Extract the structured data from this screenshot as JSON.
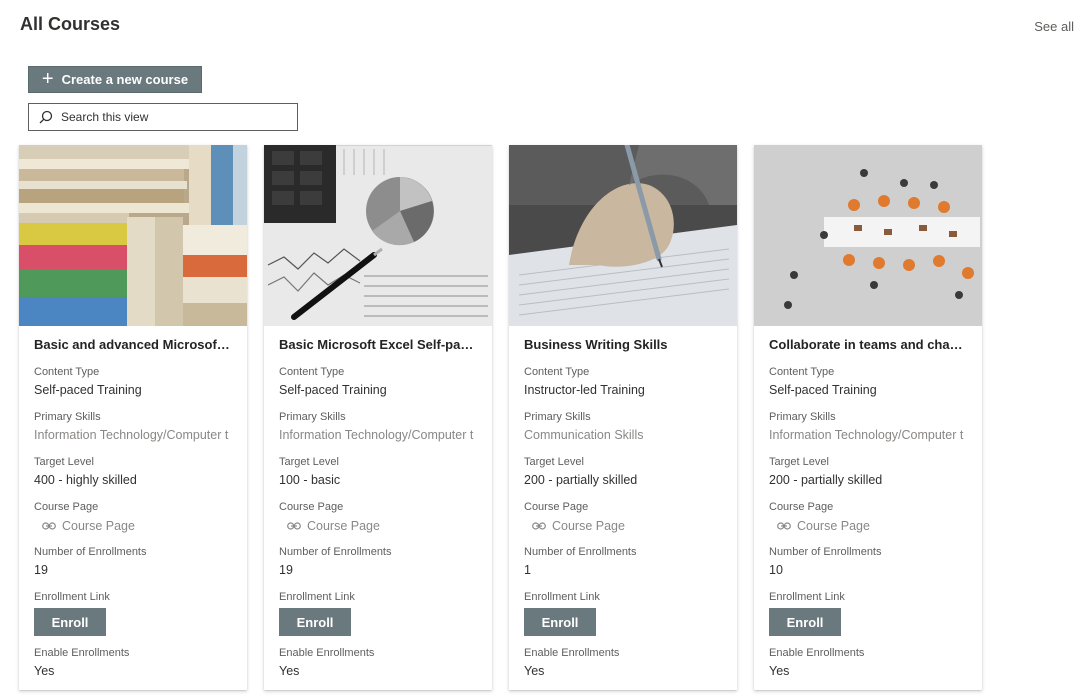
{
  "header": {
    "title": "All Courses",
    "see_all": "See all"
  },
  "toolbar": {
    "create_label": "Create a new course"
  },
  "search": {
    "placeholder": "Search this view"
  },
  "labels": {
    "content_type": "Content Type",
    "primary_skills": "Primary Skills",
    "target_level": "Target Level",
    "course_page": "Course Page",
    "enrollments": "Number of Enrollments",
    "enrollment_link": "Enrollment Link",
    "enable_enrollments": "Enable Enrollments"
  },
  "cards": [
    {
      "title": "Basic and advanced Microsoft ...",
      "content_type": "Self-paced Training",
      "primary_skills": "Information Technology/Computer t",
      "target_level": "400 - highly skilled",
      "course_page": "Course Page",
      "enrollments": "19",
      "enroll_label": "Enroll",
      "enable_enrollments": "Yes",
      "image": "books"
    },
    {
      "title": "Basic Microsoft Excel Self-pac...",
      "content_type": "Self-paced Training",
      "primary_skills": "Information Technology/Computer t",
      "target_level": "100 - basic",
      "course_page": "Course Page",
      "enrollments": "19",
      "enroll_label": "Enroll",
      "enable_enrollments": "Yes",
      "image": "charts"
    },
    {
      "title": "Business Writing Skills",
      "content_type": "Instructor-led Training",
      "primary_skills": "Communication Skills",
      "target_level": "200 - partially skilled",
      "course_page": "Course Page",
      "enrollments": "1",
      "enroll_label": "Enroll",
      "enable_enrollments": "Yes",
      "image": "writing"
    },
    {
      "title": "Collaborate in teams and chan...",
      "content_type": "Self-paced Training",
      "primary_skills": "Information Technology/Computer t",
      "target_level": "200 - partially skilled",
      "course_page": "Course Page",
      "enrollments": "10",
      "enroll_label": "Enroll",
      "enable_enrollments": "Yes",
      "image": "meeting"
    }
  ]
}
